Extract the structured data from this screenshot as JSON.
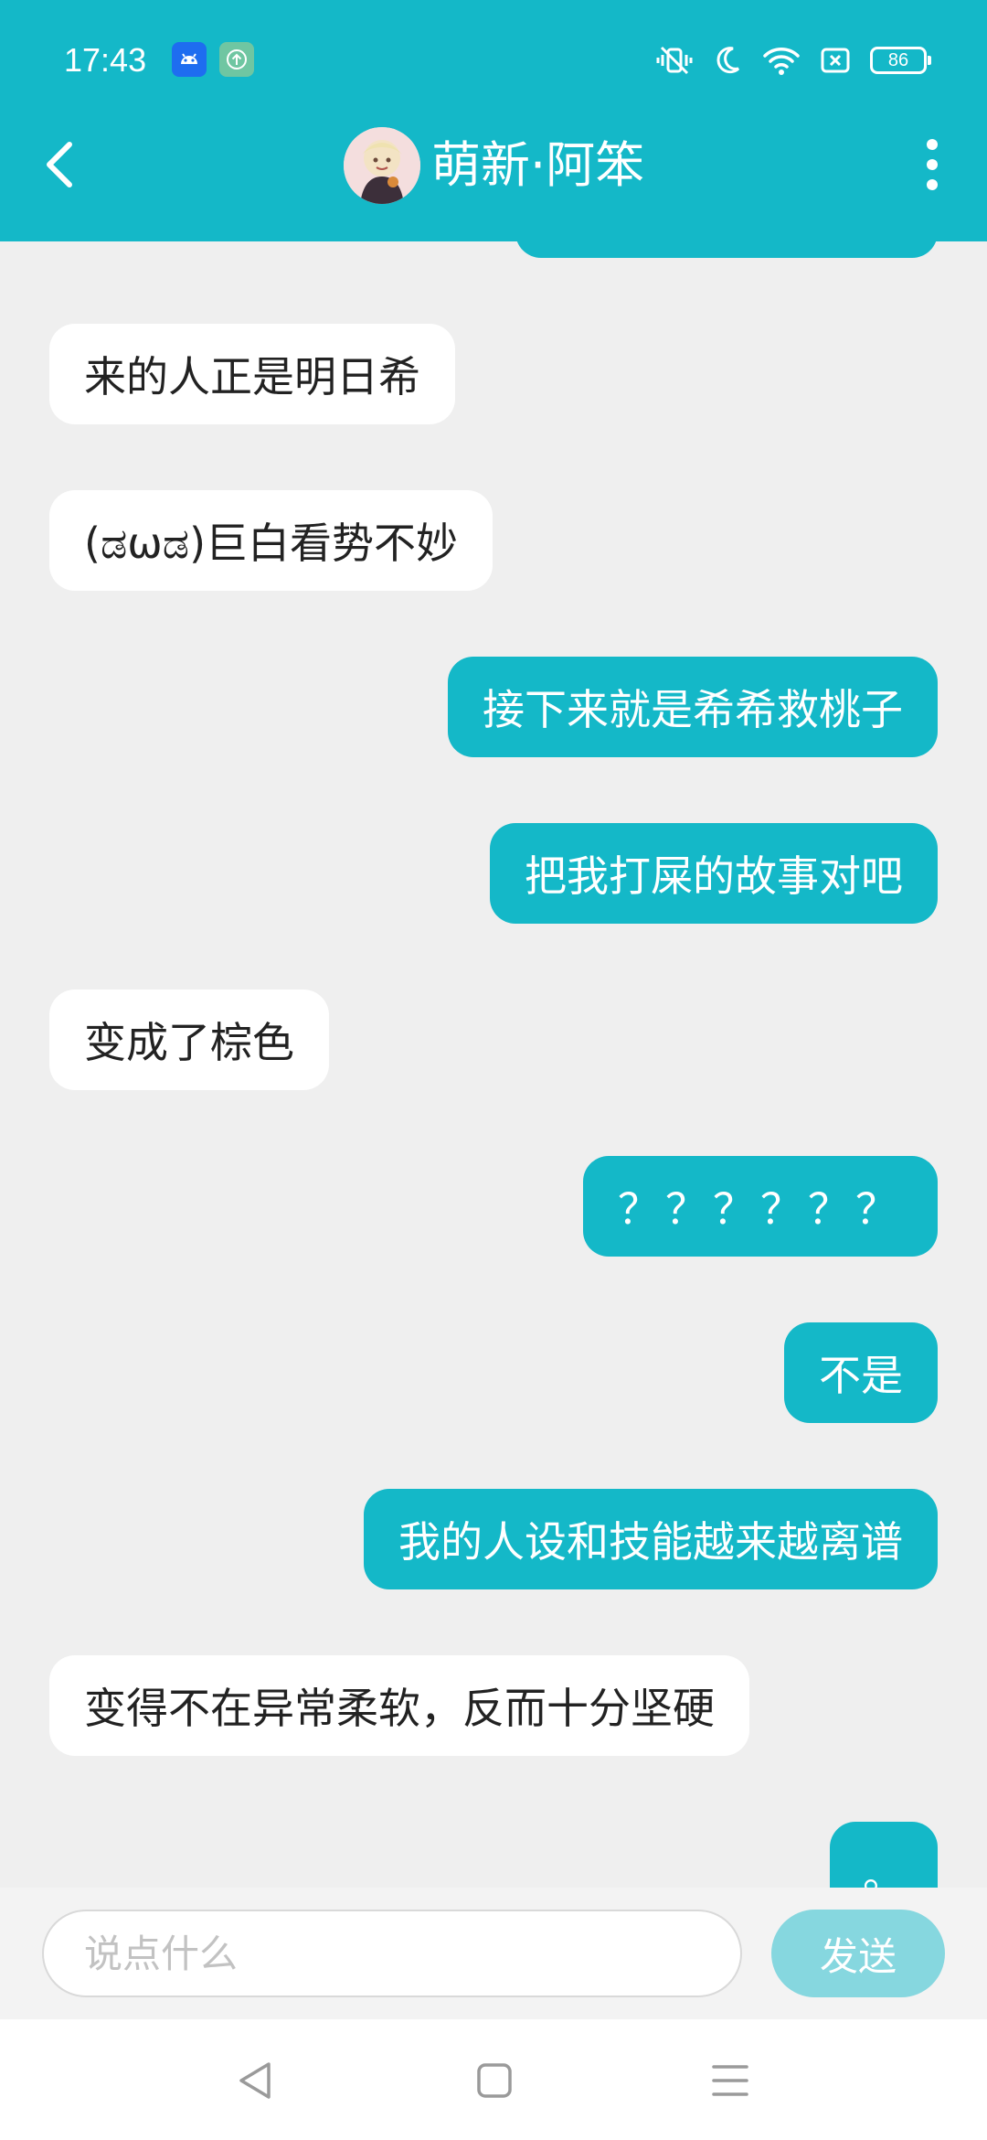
{
  "status_bar": {
    "time": "17:43",
    "battery_level": "86",
    "left_icons": [
      "android-icon",
      "upload-icon"
    ],
    "right_icons": [
      "vibrate-off-icon",
      "moon-icon",
      "wifi-icon",
      "sim-error-icon",
      "battery-icon"
    ]
  },
  "header": {
    "title": "萌新·阿笨",
    "back_icon": "chevron-left-icon",
    "menu_icon": "more-vertical-icon"
  },
  "messages": [
    {
      "side": "in",
      "text": "来的人正是明日希"
    },
    {
      "side": "in",
      "text": "(ಡωಡ)巨白看势不妙"
    },
    {
      "side": "out",
      "text": "接下来就是希希救桃子"
    },
    {
      "side": "out",
      "text": "把我打屎的故事对吧"
    },
    {
      "side": "in",
      "text": "变成了棕色"
    },
    {
      "side": "out",
      "text": "？？？？？？"
    },
    {
      "side": "out",
      "text": "不是"
    },
    {
      "side": "out",
      "text": "我的人设和技能越来越离谱"
    },
    {
      "side": "in",
      "text": "变得不在异常柔软，反而十分坚硬"
    },
    {
      "side": "out",
      "text": "。"
    }
  ],
  "input": {
    "value": "",
    "placeholder": "说点什么",
    "send_label": "发送"
  },
  "nav_bar": {
    "icons": [
      "back-triangle-icon",
      "home-square-icon",
      "menu-lines-icon"
    ]
  },
  "colors": {
    "accent": "#14b8c8",
    "background": "#efefef",
    "send_disabled": "#86d7df"
  }
}
